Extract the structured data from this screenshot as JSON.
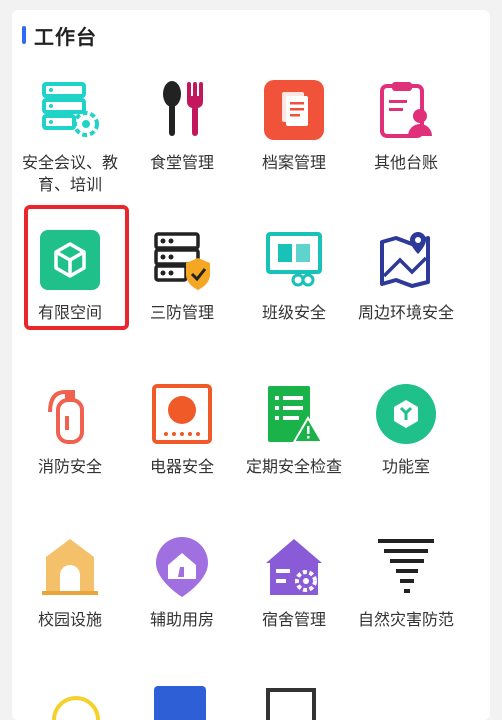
{
  "header": {
    "title": "工作台"
  },
  "colors": {
    "accent": "#2f6df6",
    "highlight": "#e8262b"
  },
  "tiles": [
    {
      "label": "安全会议、教育、培训",
      "icon": "server-gear-icon"
    },
    {
      "label": "食堂管理",
      "icon": "spoon-fork-icon"
    },
    {
      "label": "档案管理",
      "icon": "archive-doc-icon"
    },
    {
      "label": "其他台账",
      "icon": "clipboard-user-icon"
    },
    {
      "label": "有限空间",
      "icon": "cube-icon"
    },
    {
      "label": "三防管理",
      "icon": "server-shield-icon"
    },
    {
      "label": "班级安全",
      "icon": "book-screen-icon"
    },
    {
      "label": "周边环境安全",
      "icon": "map-pin-icon"
    },
    {
      "label": "消防安全",
      "icon": "fire-extinguisher-icon"
    },
    {
      "label": "电器安全",
      "icon": "stove-icon"
    },
    {
      "label": "定期安全检查",
      "icon": "checklist-warning-icon"
    },
    {
      "label": "功能室",
      "icon": "function-room-icon"
    },
    {
      "label": "校园设施",
      "icon": "school-gate-icon"
    },
    {
      "label": "辅助用房",
      "icon": "house-badge-icon"
    },
    {
      "label": "宿舍管理",
      "icon": "dorm-gear-icon"
    },
    {
      "label": "自然灾害防范",
      "icon": "tornado-icon"
    }
  ]
}
